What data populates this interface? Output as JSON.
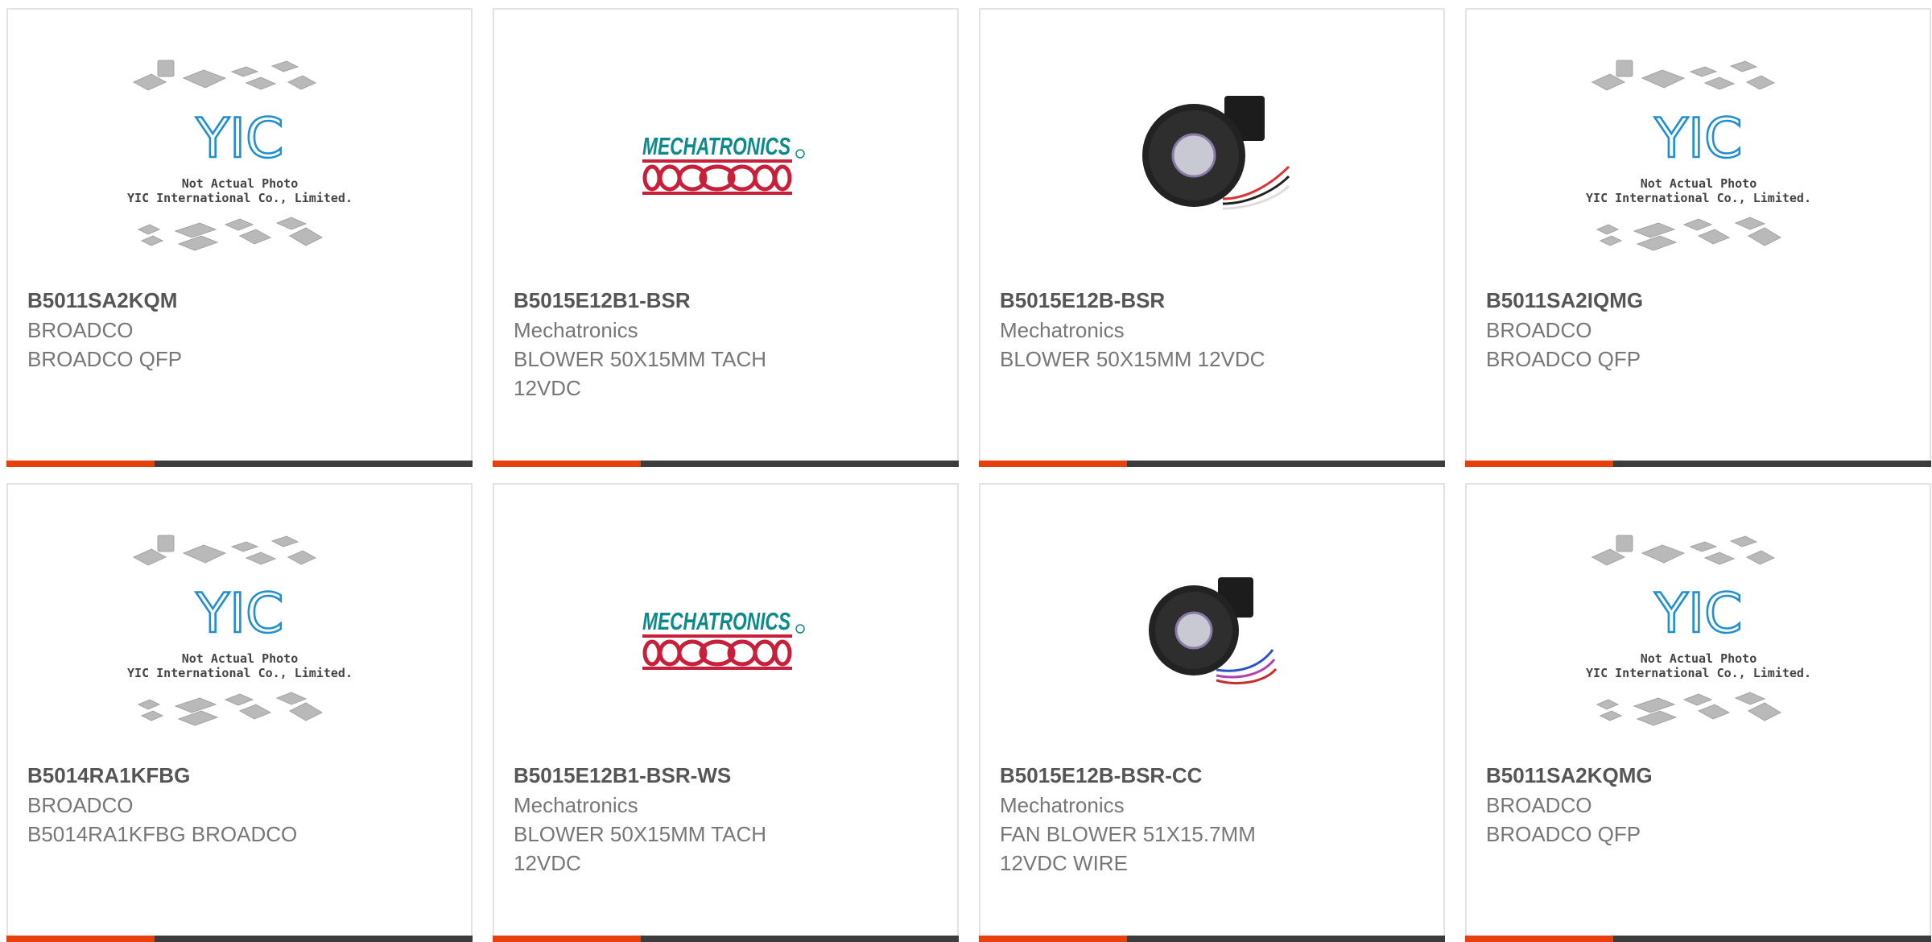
{
  "products": [
    {
      "part_number": "B5011SA2KQM",
      "manufacturer": "BROADCO",
      "description": "BROADCO QFP",
      "image": "yic-placeholder"
    },
    {
      "part_number": "B5015E12B1-BSR",
      "manufacturer": "Mechatronics",
      "description": "BLOWER 50X15MM TACH 12VDC",
      "image": "mechatronics-logo"
    },
    {
      "part_number": "B5015E12B-BSR",
      "manufacturer": "Mechatronics",
      "description": "BLOWER 50X15MM 12VDC",
      "image": "blower-fan-photo"
    },
    {
      "part_number": "B5011SA2IQMG",
      "manufacturer": "BROADCO",
      "description": "BROADCO QFP",
      "image": "yic-placeholder"
    },
    {
      "part_number": "B5014RA1KFBG",
      "manufacturer": "BROADCO",
      "description": "B5014RA1KFBG BROADCO",
      "image": "yic-placeholder"
    },
    {
      "part_number": "B5015E12B1-BSR-WS",
      "manufacturer": "Mechatronics",
      "description": "BLOWER 50X15MM TACH 12VDC",
      "image": "mechatronics-logo"
    },
    {
      "part_number": "B5015E12B-BSR-CC",
      "manufacturer": "Mechatronics",
      "description": "FAN BLOWER 51X15.7MM 12VDC WIRE",
      "image": "blower-fan-photo"
    },
    {
      "part_number": "B5011SA2KQMG",
      "manufacturer": "BROADCO",
      "description": "BROADCO QFP",
      "image": "yic-placeholder"
    }
  ],
  "placeholder": {
    "logo_text": "YIC",
    "line1": "Not Actual Photo",
    "line2": "YIC International Co., Limited."
  },
  "mechatronics_logo_text": "MECHATRONICS",
  "colors": {
    "accent": "#e8400c",
    "bar": "#3c3c3c",
    "border": "#e3e3e3",
    "brand_blue": "#1f8fd0",
    "brand_teal": "#0c8a8a",
    "brand_red": "#c8203a"
  }
}
